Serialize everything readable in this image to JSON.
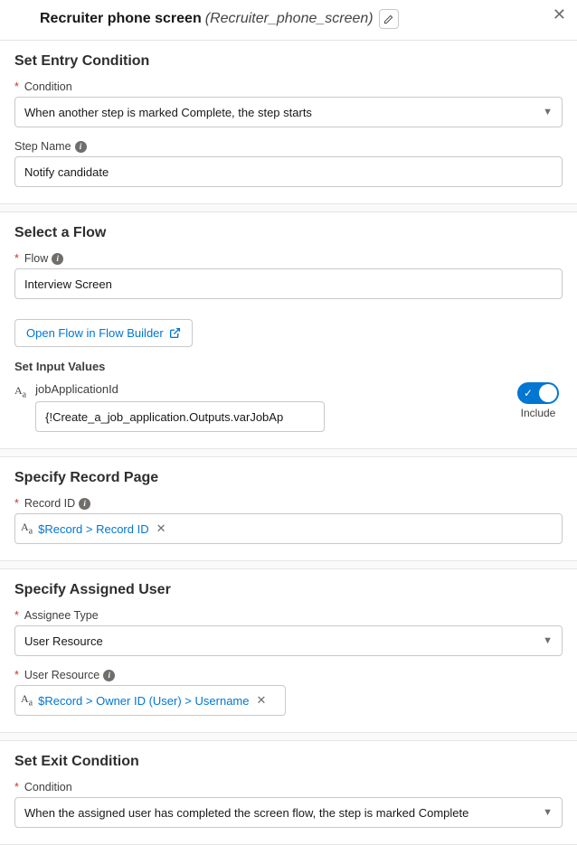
{
  "header": {
    "title": "Recruiter phone screen",
    "api_name": "(Recruiter_phone_screen)"
  },
  "entry": {
    "section_title": "Set Entry Condition",
    "condition_label": "Condition",
    "condition_value": "When another step is marked Complete, the step starts",
    "step_name_label": "Step Name",
    "step_name_value": "Notify candidate"
  },
  "flow": {
    "section_title": "Select a Flow",
    "flow_label": "Flow",
    "flow_value": "Interview Screen",
    "open_btn": "Open Flow in Flow Builder",
    "input_values_title": "Set Input Values",
    "var_name": "jobApplicationId",
    "var_value": "{!Create_a_job_application.Outputs.varJobAp",
    "toggle_label": "Include"
  },
  "record": {
    "section_title": "Specify Record Page",
    "record_id_label": "Record ID",
    "record_id_pill": "$Record > Record ID"
  },
  "assignee": {
    "section_title": "Specify Assigned User",
    "type_label": "Assignee Type",
    "type_value": "User Resource",
    "resource_label": "User Resource",
    "resource_pill": "$Record > Owner ID (User) > Username"
  },
  "exit": {
    "section_title": "Set Exit Condition",
    "condition_label": "Condition",
    "condition_value": "When the assigned user has completed the screen flow, the step is marked Complete"
  }
}
